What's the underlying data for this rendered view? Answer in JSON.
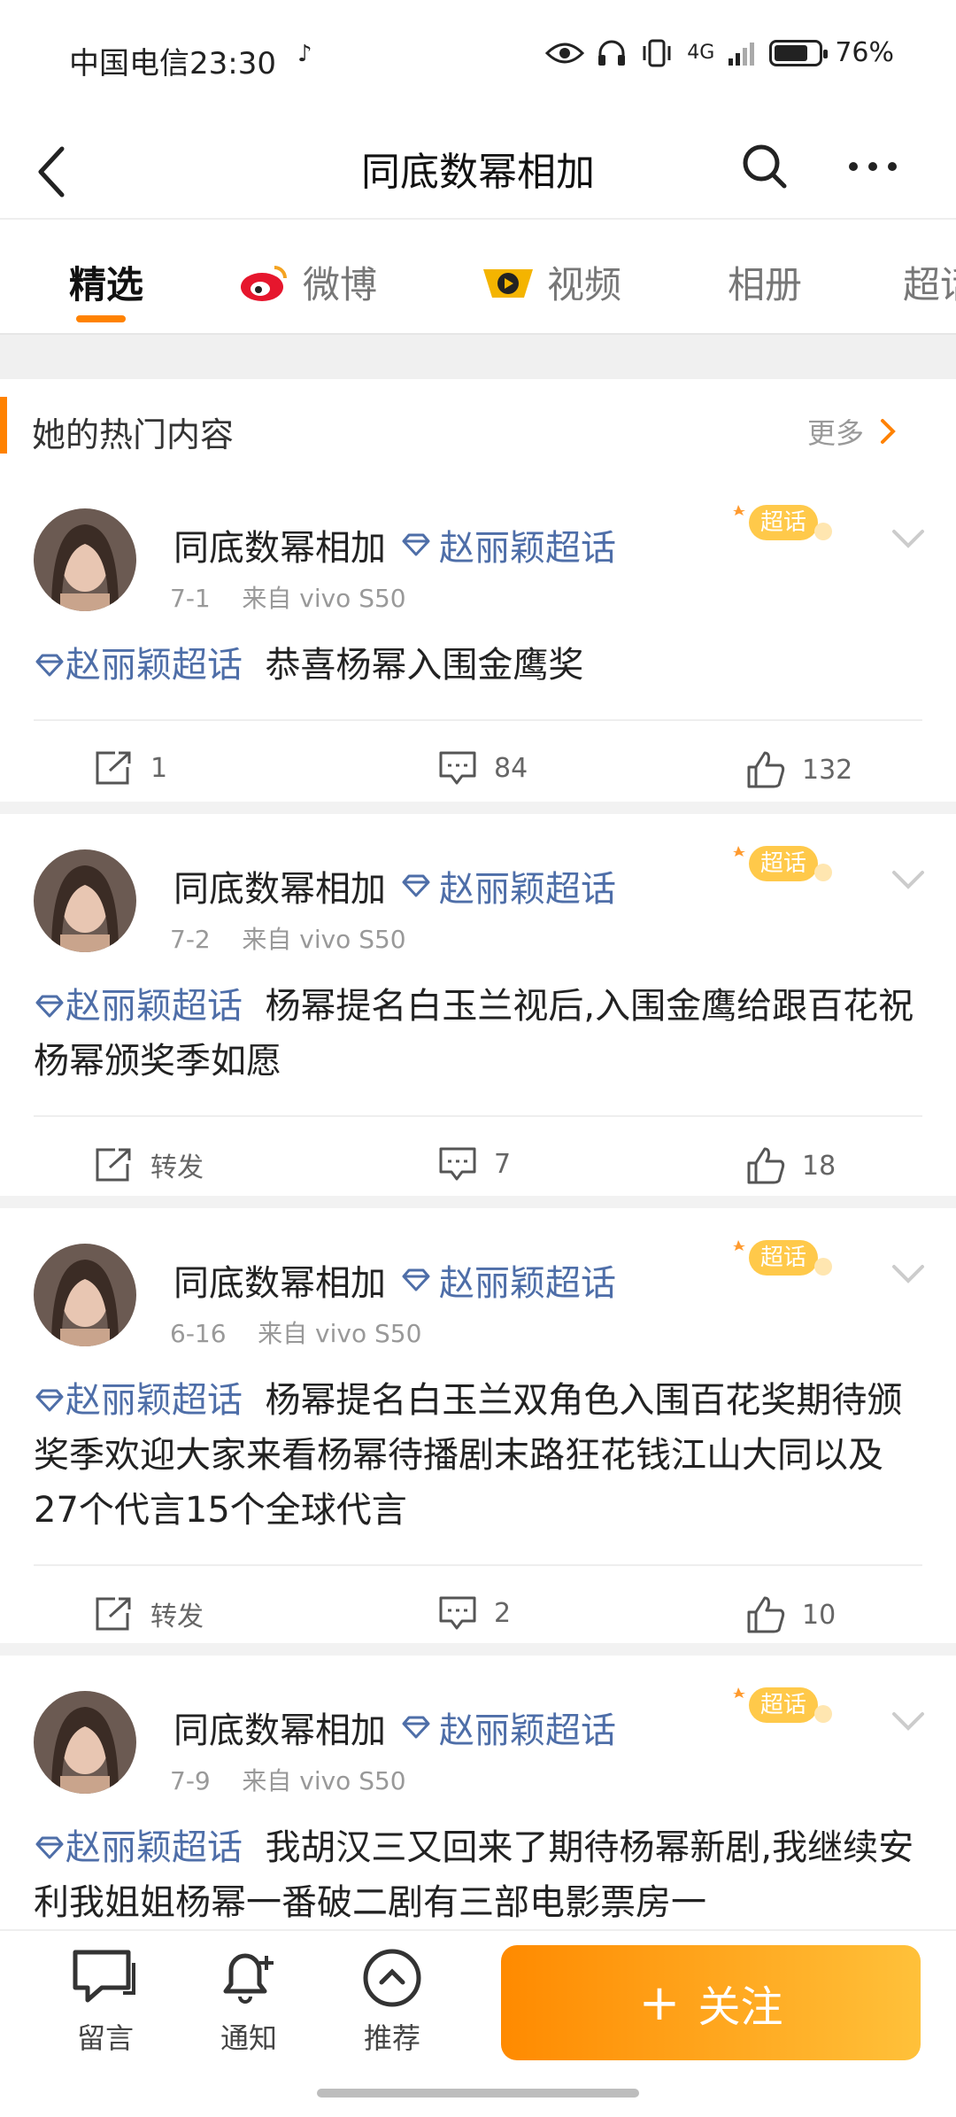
{
  "status": {
    "carrier_time": "中国电信23:30",
    "network": "4G",
    "battery": "76%",
    "battery_level": 0.76
  },
  "header": {
    "title": "同底数幂相加"
  },
  "tabs": [
    {
      "label": "精选"
    },
    {
      "label": "微博"
    },
    {
      "label": "视频"
    },
    {
      "label": "相册"
    },
    {
      "label": "超话"
    }
  ],
  "section": {
    "title": "她的热门内容",
    "more": "更多"
  },
  "badge_label": "超话",
  "posts": [
    {
      "author": "同底数幂相加",
      "topic": "赵丽颖超话",
      "date": "7-1",
      "source": "来自 vivo S50",
      "content": "恭喜杨幂入围金鹰奖",
      "repost": "1",
      "comments": "84",
      "likes": "132"
    },
    {
      "author": "同底数幂相加",
      "topic": "赵丽颖超话",
      "date": "7-2",
      "source": "来自 vivo S50",
      "content": "杨幂提名白玉兰视后,入围金鹰给跟百花祝杨幂颁奖季如愿",
      "repost": "转发",
      "comments": "7",
      "likes": "18"
    },
    {
      "author": "同底数幂相加",
      "topic": "赵丽颖超话",
      "date": "6-16",
      "source": "来自 vivo S50",
      "content": "杨幂提名白玉兰双角色入围百花奖期待颁奖季欢迎大家来看杨幂待播剧末路狂花钱江山大同以及27个代言15个全球代言",
      "repost": "转发",
      "comments": "2",
      "likes": "10"
    },
    {
      "author": "同底数幂相加",
      "topic": "赵丽颖超话",
      "date": "7-9",
      "source": "来自 vivo S50",
      "content": "我胡汉三又回来了期待杨幂新剧,我继续安利我姐姐杨幂一番破二剧有三部电影票房一"
    }
  ],
  "bottom": {
    "message": "留言",
    "notify": "通知",
    "recommend": "推荐",
    "follow": "关注"
  }
}
